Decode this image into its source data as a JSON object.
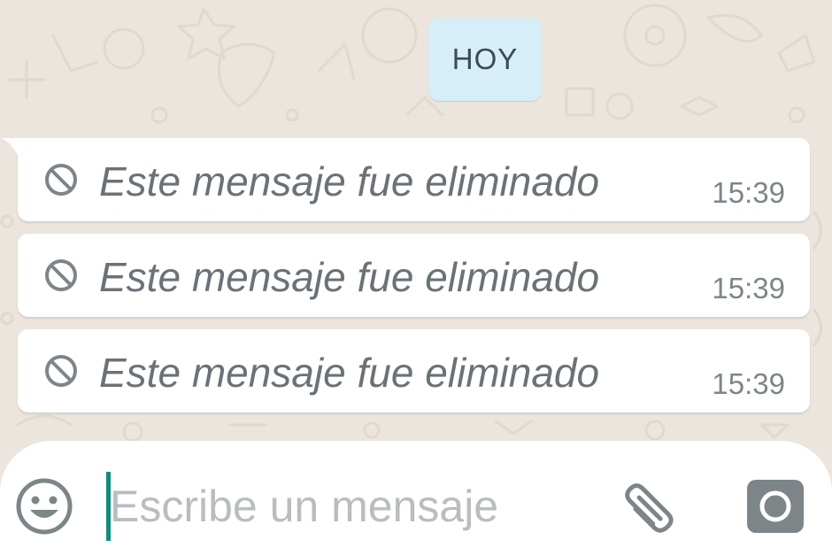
{
  "chat": {
    "date_label": "HOY",
    "messages": [
      {
        "text": "Este mensaje fue eliminado",
        "time": "15:39",
        "status_icon": "ban-icon"
      },
      {
        "text": "Este mensaje fue eliminado",
        "time": "15:39",
        "status_icon": "ban-icon"
      },
      {
        "text": "Este mensaje fue eliminado",
        "time": "15:39",
        "status_icon": "ban-icon"
      }
    ]
  },
  "composer": {
    "placeholder": "Escribe un mensaje",
    "value": "",
    "icons": {
      "emoji": "emoji-icon",
      "attach": "paperclip-icon",
      "camera": "camera-icon"
    }
  },
  "colors": {
    "chat_background": "#ece5dd",
    "date_chip": "#d6eef8",
    "bubble": "#ffffff",
    "caret": "#128c7e",
    "icon_gray": "#7d8589"
  }
}
